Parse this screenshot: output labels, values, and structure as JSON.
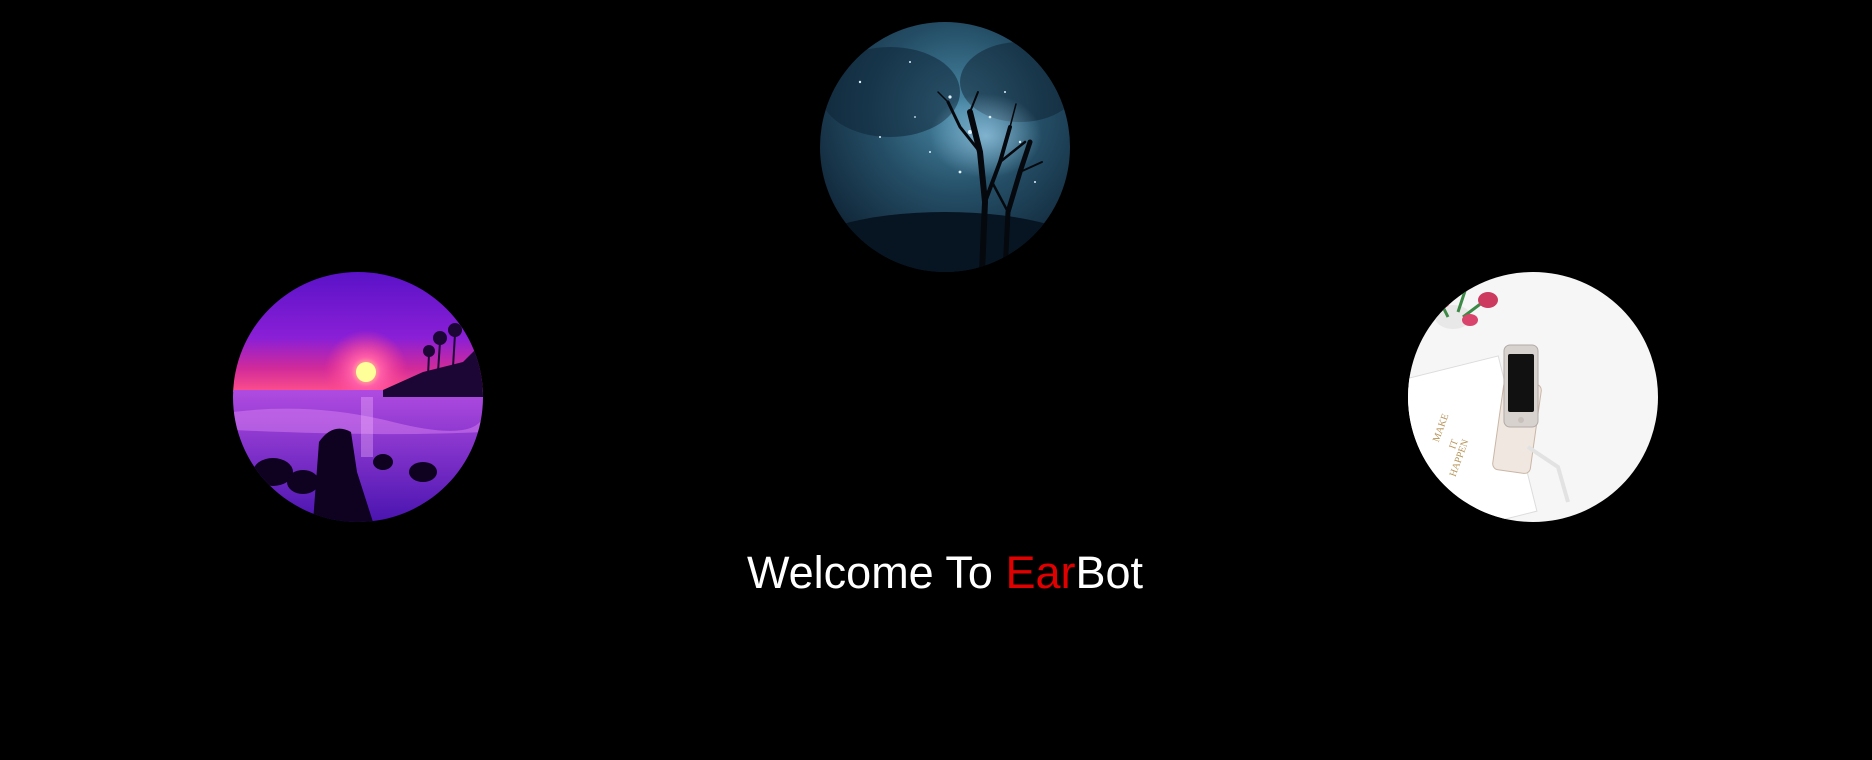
{
  "theme": {
    "background": "#000000",
    "text_color": "#ffffff",
    "accent_color": "#e00000"
  },
  "hero": {
    "prefix": "Welcome To ",
    "brand_accent": "Ear",
    "brand_rest": "Bot"
  },
  "gallery": {
    "images": [
      {
        "icon": "night-sky-trees-image"
      },
      {
        "icon": "purple-beach-sunset-image"
      },
      {
        "icon": "desk-phone-flowers-image"
      }
    ]
  }
}
